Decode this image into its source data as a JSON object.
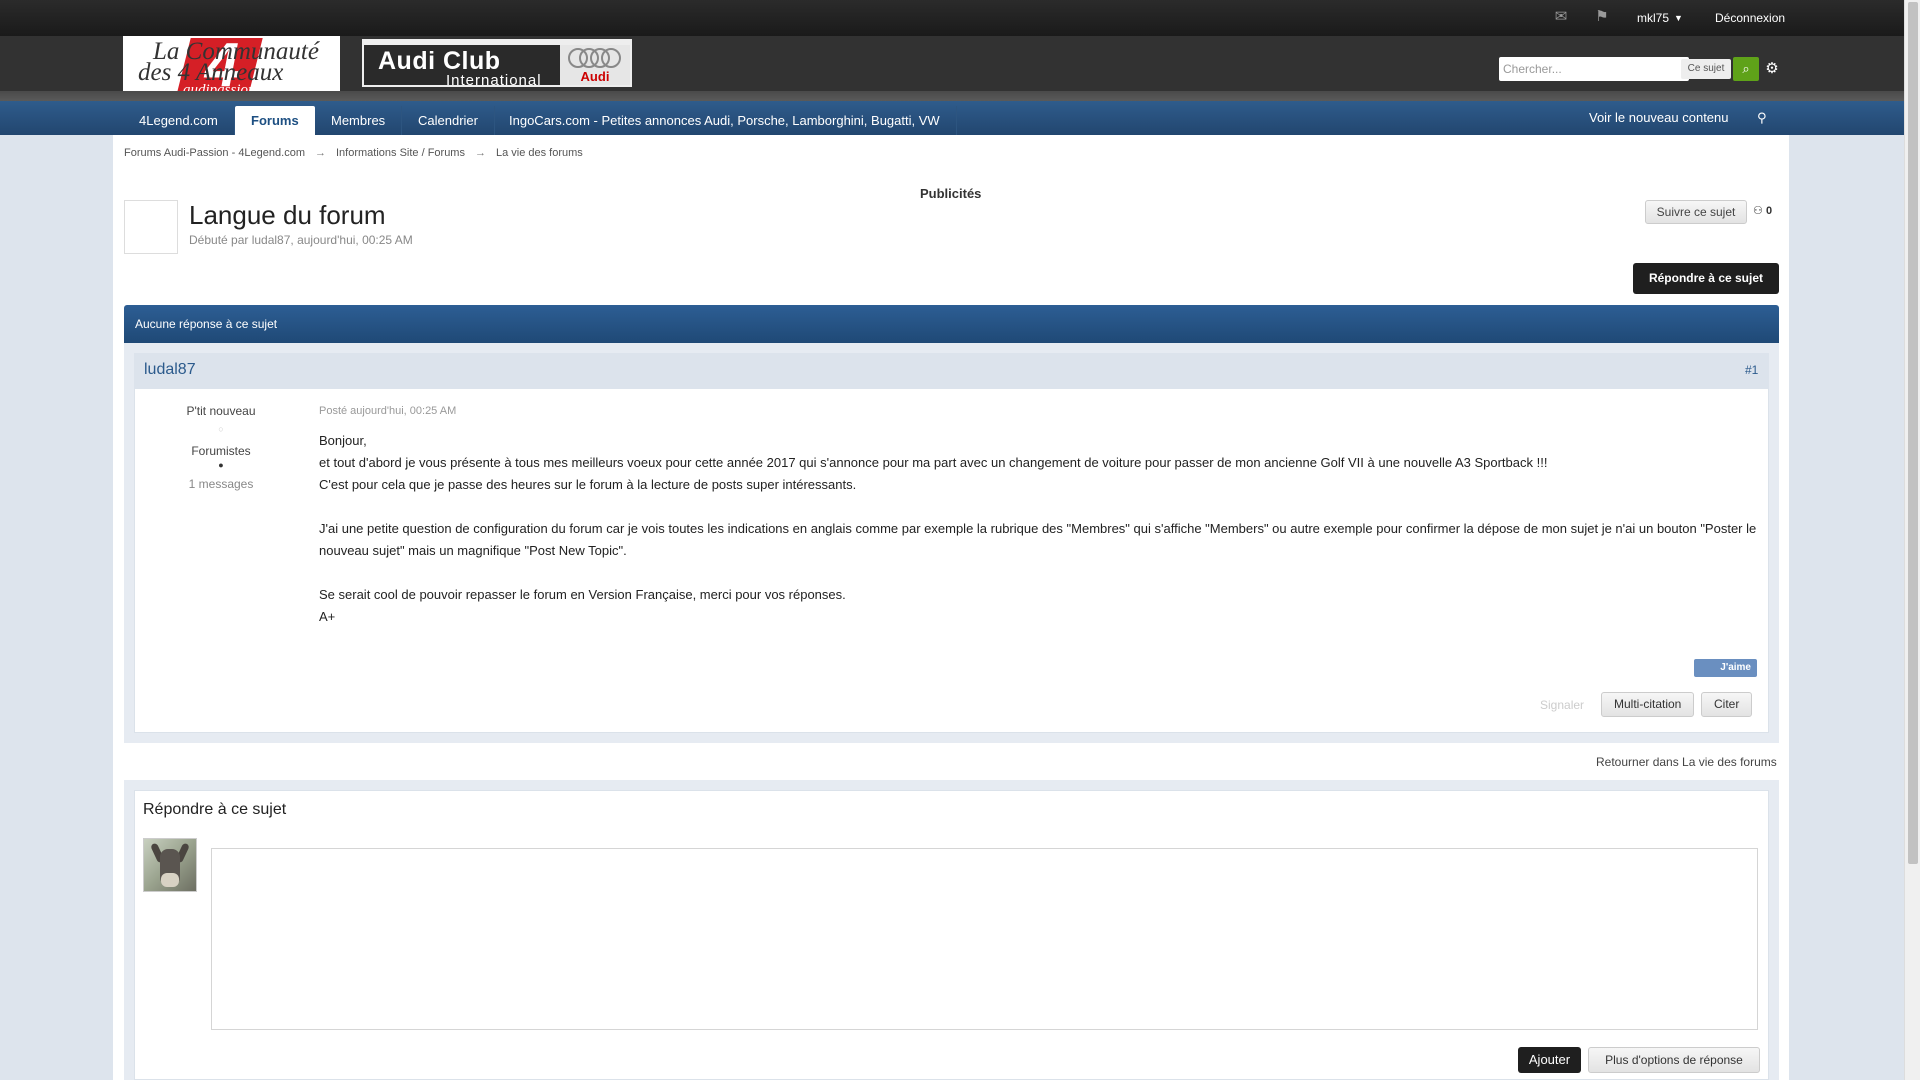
{
  "topbar": {
    "user": "mkl75",
    "logout": "Déconnexion",
    "icons": [
      "inbox-icon",
      "notifications-icon"
    ]
  },
  "logo1": {
    "line1": "La Communauté",
    "line2": "des 4 Anneaux",
    "big": "4",
    "site": "audipassion.com"
  },
  "logo2": {
    "club": "Audi Club",
    "intl": "International",
    "audi": "Audi"
  },
  "search": {
    "placeholder": "Chercher...",
    "scope": "Ce sujet"
  },
  "nav": {
    "tabs": [
      "4Legend.com",
      "Forums",
      "Membres",
      "Calendrier",
      "IngoCars.com - Petites annonces Audi, Porsche, Lamborghini, Bugatti, VW"
    ],
    "active": "Forums",
    "new_content": "Voir le nouveau contenu"
  },
  "breadcrumb": [
    "Forums Audi-Passion - 4Legend.com",
    "Informations Site / Forums",
    "La vie des forums"
  ],
  "breadcrumb_sep": "→",
  "ads_label": "Publicités",
  "topic": {
    "title": "Langue du forum",
    "started": "Débuté par ludal87, aujourd'hui, 00:25 AM",
    "follow": "Suivre ce sujet",
    "followers": "0",
    "reply_button": "Répondre à ce sujet",
    "no_replies": "Aucune réponse à ce sujet"
  },
  "post": {
    "author": "ludal87",
    "number": "#1",
    "rank": "P'tit nouveau",
    "rank_pip": "○",
    "group": "Forumistes",
    "group_dot": "●",
    "count": "1 messages",
    "posted": "Posté aujourd'hui, 00:25 AM",
    "lines": [
      "Bonjour,",
      "et tout d'abord je vous présente à tous mes meilleurs voeux pour cette année 2017 qui s'annonce pour ma part avec un changement de voiture pour passer de mon ancienne Golf VII à une nouvelle A3 Sportback !!!",
      "C'est pour cela que je passe des heures sur le forum à la lecture de posts super intéressants.",
      "",
      "J'ai une petite question de configuration du forum car je vois toutes les indications en anglais comme par exemple la rubrique des \"Membres\" qui s'affiche \"Members\" ou autre exemple pour confirmer la dépose de mon sujet je n'ai un bouton \"Poster le nouveau sujet\" mais un magnifique \"Post New Topic\".",
      "",
      "Se serait cool de pouvoir repasser le forum en Version Française, merci pour vos réponses.",
      "A+"
    ],
    "like": "J'aime",
    "report": "Signaler",
    "multiquote": "Multi-citation",
    "quote": "Citer"
  },
  "back_link": "Retourner dans La vie des forums",
  "reply": {
    "title": "Répondre à ce sujet",
    "submit": "Ajouter",
    "more_options": "Plus d'options de réponse"
  }
}
